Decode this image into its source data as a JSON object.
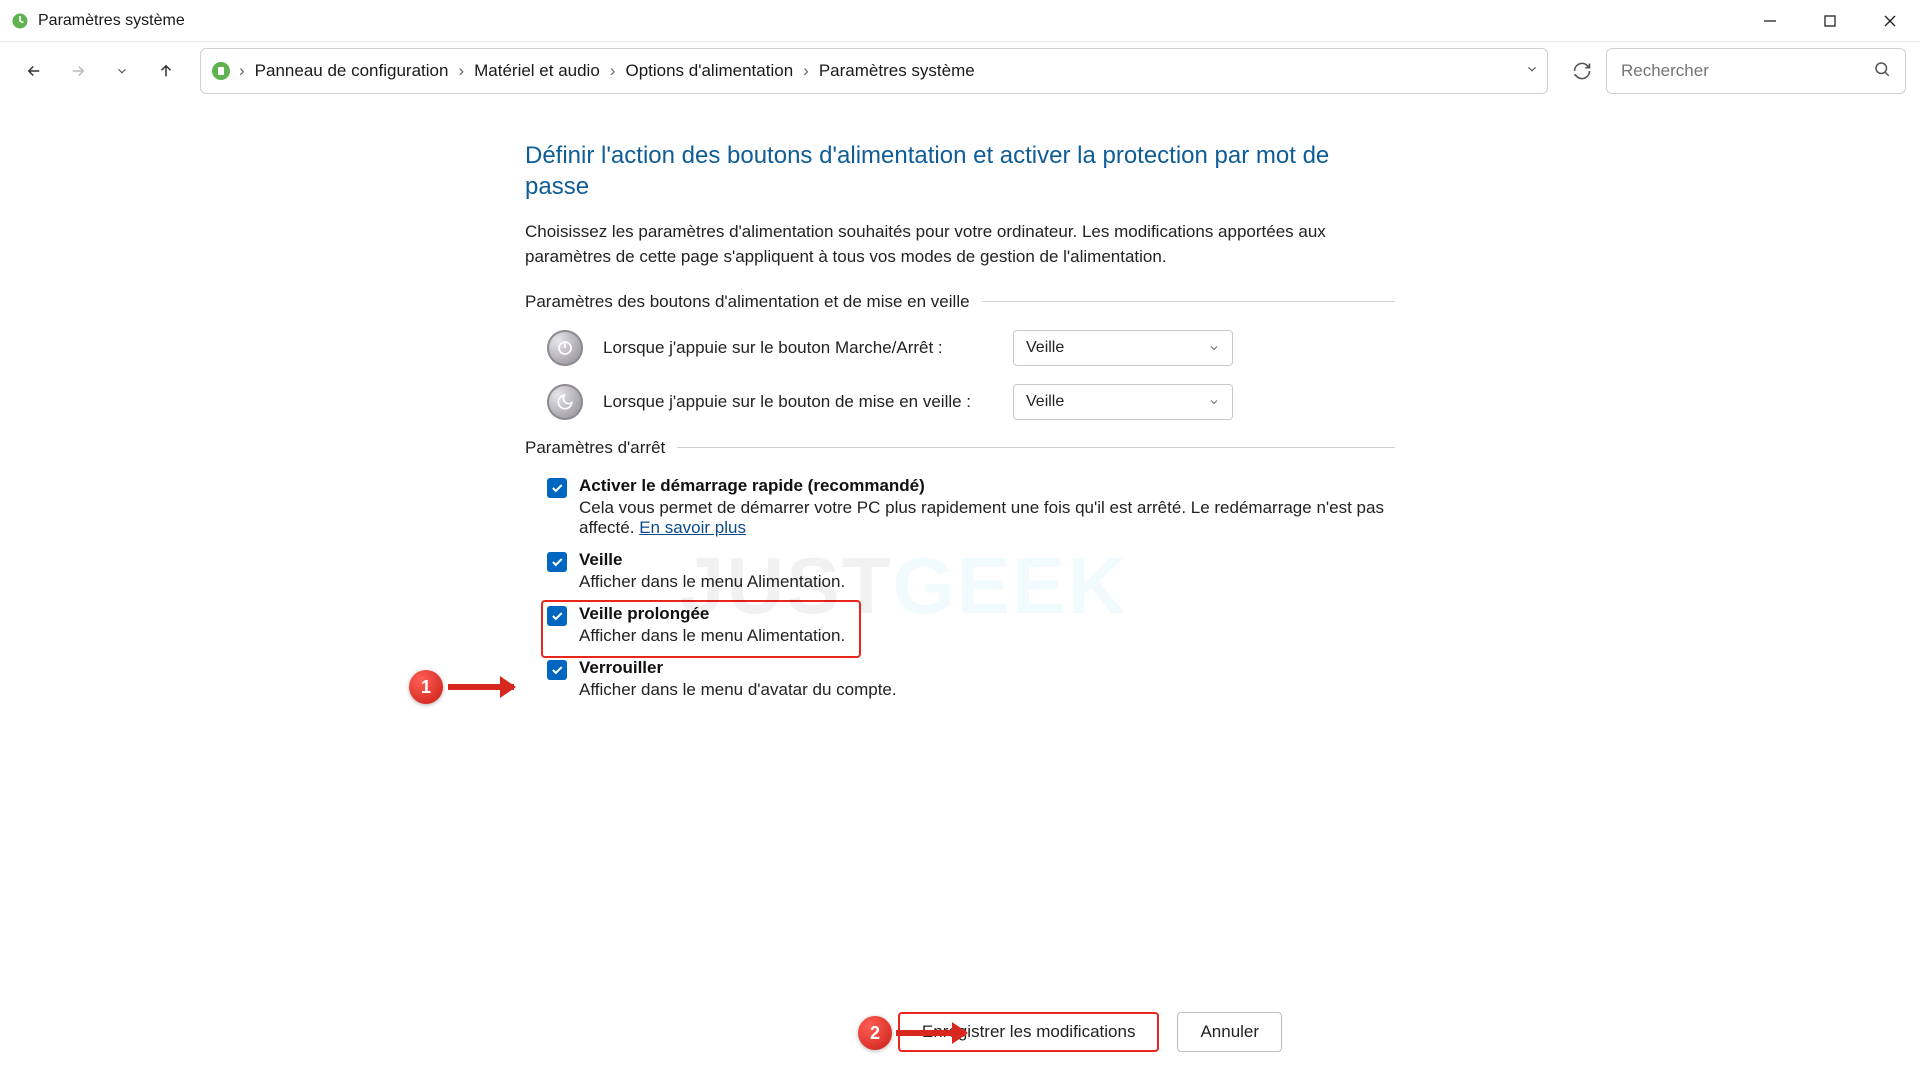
{
  "window": {
    "title": "Paramètres système"
  },
  "breadcrumb": {
    "items": [
      "Panneau de configuration",
      "Matériel et audio",
      "Options d'alimentation",
      "Paramètres système"
    ]
  },
  "search": {
    "placeholder": "Rechercher"
  },
  "page": {
    "heading": "Définir l'action des boutons d'alimentation et activer la protection par mot de passe",
    "description": "Choisissez les paramètres d'alimentation souhaités pour votre ordinateur. Les modifications apportées aux paramètres de cette page s'appliquent à tous vos modes de gestion de l'alimentation."
  },
  "sections": {
    "power_buttons_label": "Paramètres des boutons d'alimentation et de mise en veille",
    "power_button": {
      "label": "Lorsque j'appuie sur le bouton Marche/Arrêt :",
      "value": "Veille"
    },
    "sleep_button": {
      "label": "Lorsque j'appuie sur le bouton de mise en veille :",
      "value": "Veille"
    },
    "shutdown_label": "Paramètres d'arrêt"
  },
  "checkboxes": {
    "fast_startup": {
      "title": "Activer le démarrage rapide (recommandé)",
      "desc": "Cela vous permet de démarrer votre PC plus rapidement une fois qu'il est arrêté. Le redémarrage n'est pas affecté. ",
      "link": "En savoir plus"
    },
    "sleep": {
      "title": "Veille",
      "desc": "Afficher dans le menu Alimentation."
    },
    "hibernate": {
      "title": "Veille prolongée",
      "desc": "Afficher dans le menu Alimentation."
    },
    "lock": {
      "title": "Verrouiller",
      "desc": "Afficher dans le menu d'avatar du compte."
    }
  },
  "footer": {
    "save": "Enregistrer les modifications",
    "cancel": "Annuler"
  },
  "annotations": {
    "badge1": "1",
    "badge2": "2"
  },
  "watermark": {
    "part1": "JUST",
    "part2": "GEEK"
  }
}
